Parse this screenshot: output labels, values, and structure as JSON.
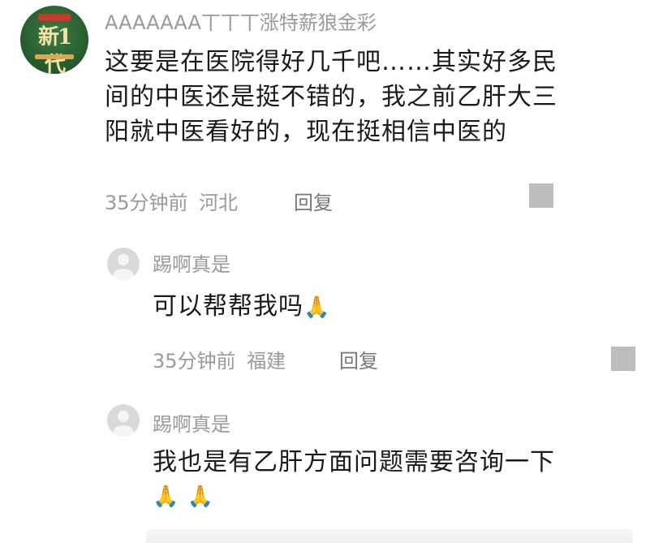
{
  "comments": [
    {
      "username": "AAAAAAA丅丅丅涨特薪狼金彩",
      "text_lines": [
        "这要是在医院得好几千吧……其实好多民",
        "间的中医还是挺不错的，我之前乙肝大三",
        "阳就中医看好的，现在挺相信中医的"
      ],
      "time": "35分钟前",
      "location": "河北",
      "reply_label": "回复"
    }
  ],
  "replies": [
    {
      "username": "踢啊真是",
      "text": "可以帮帮我吗",
      "emoji": "🙏",
      "time": "35分钟前",
      "location": "福建",
      "reply_label": "回复"
    },
    {
      "username": "踢啊真是",
      "text": "我也是有乙肝方面问题需要咨询一下",
      "emoji": "🙏 🙏"
    }
  ],
  "avatar_badge": "新1代",
  "colors": {
    "meta_gray": "#9a9a9a",
    "more_box": "#bdbdbd"
  }
}
